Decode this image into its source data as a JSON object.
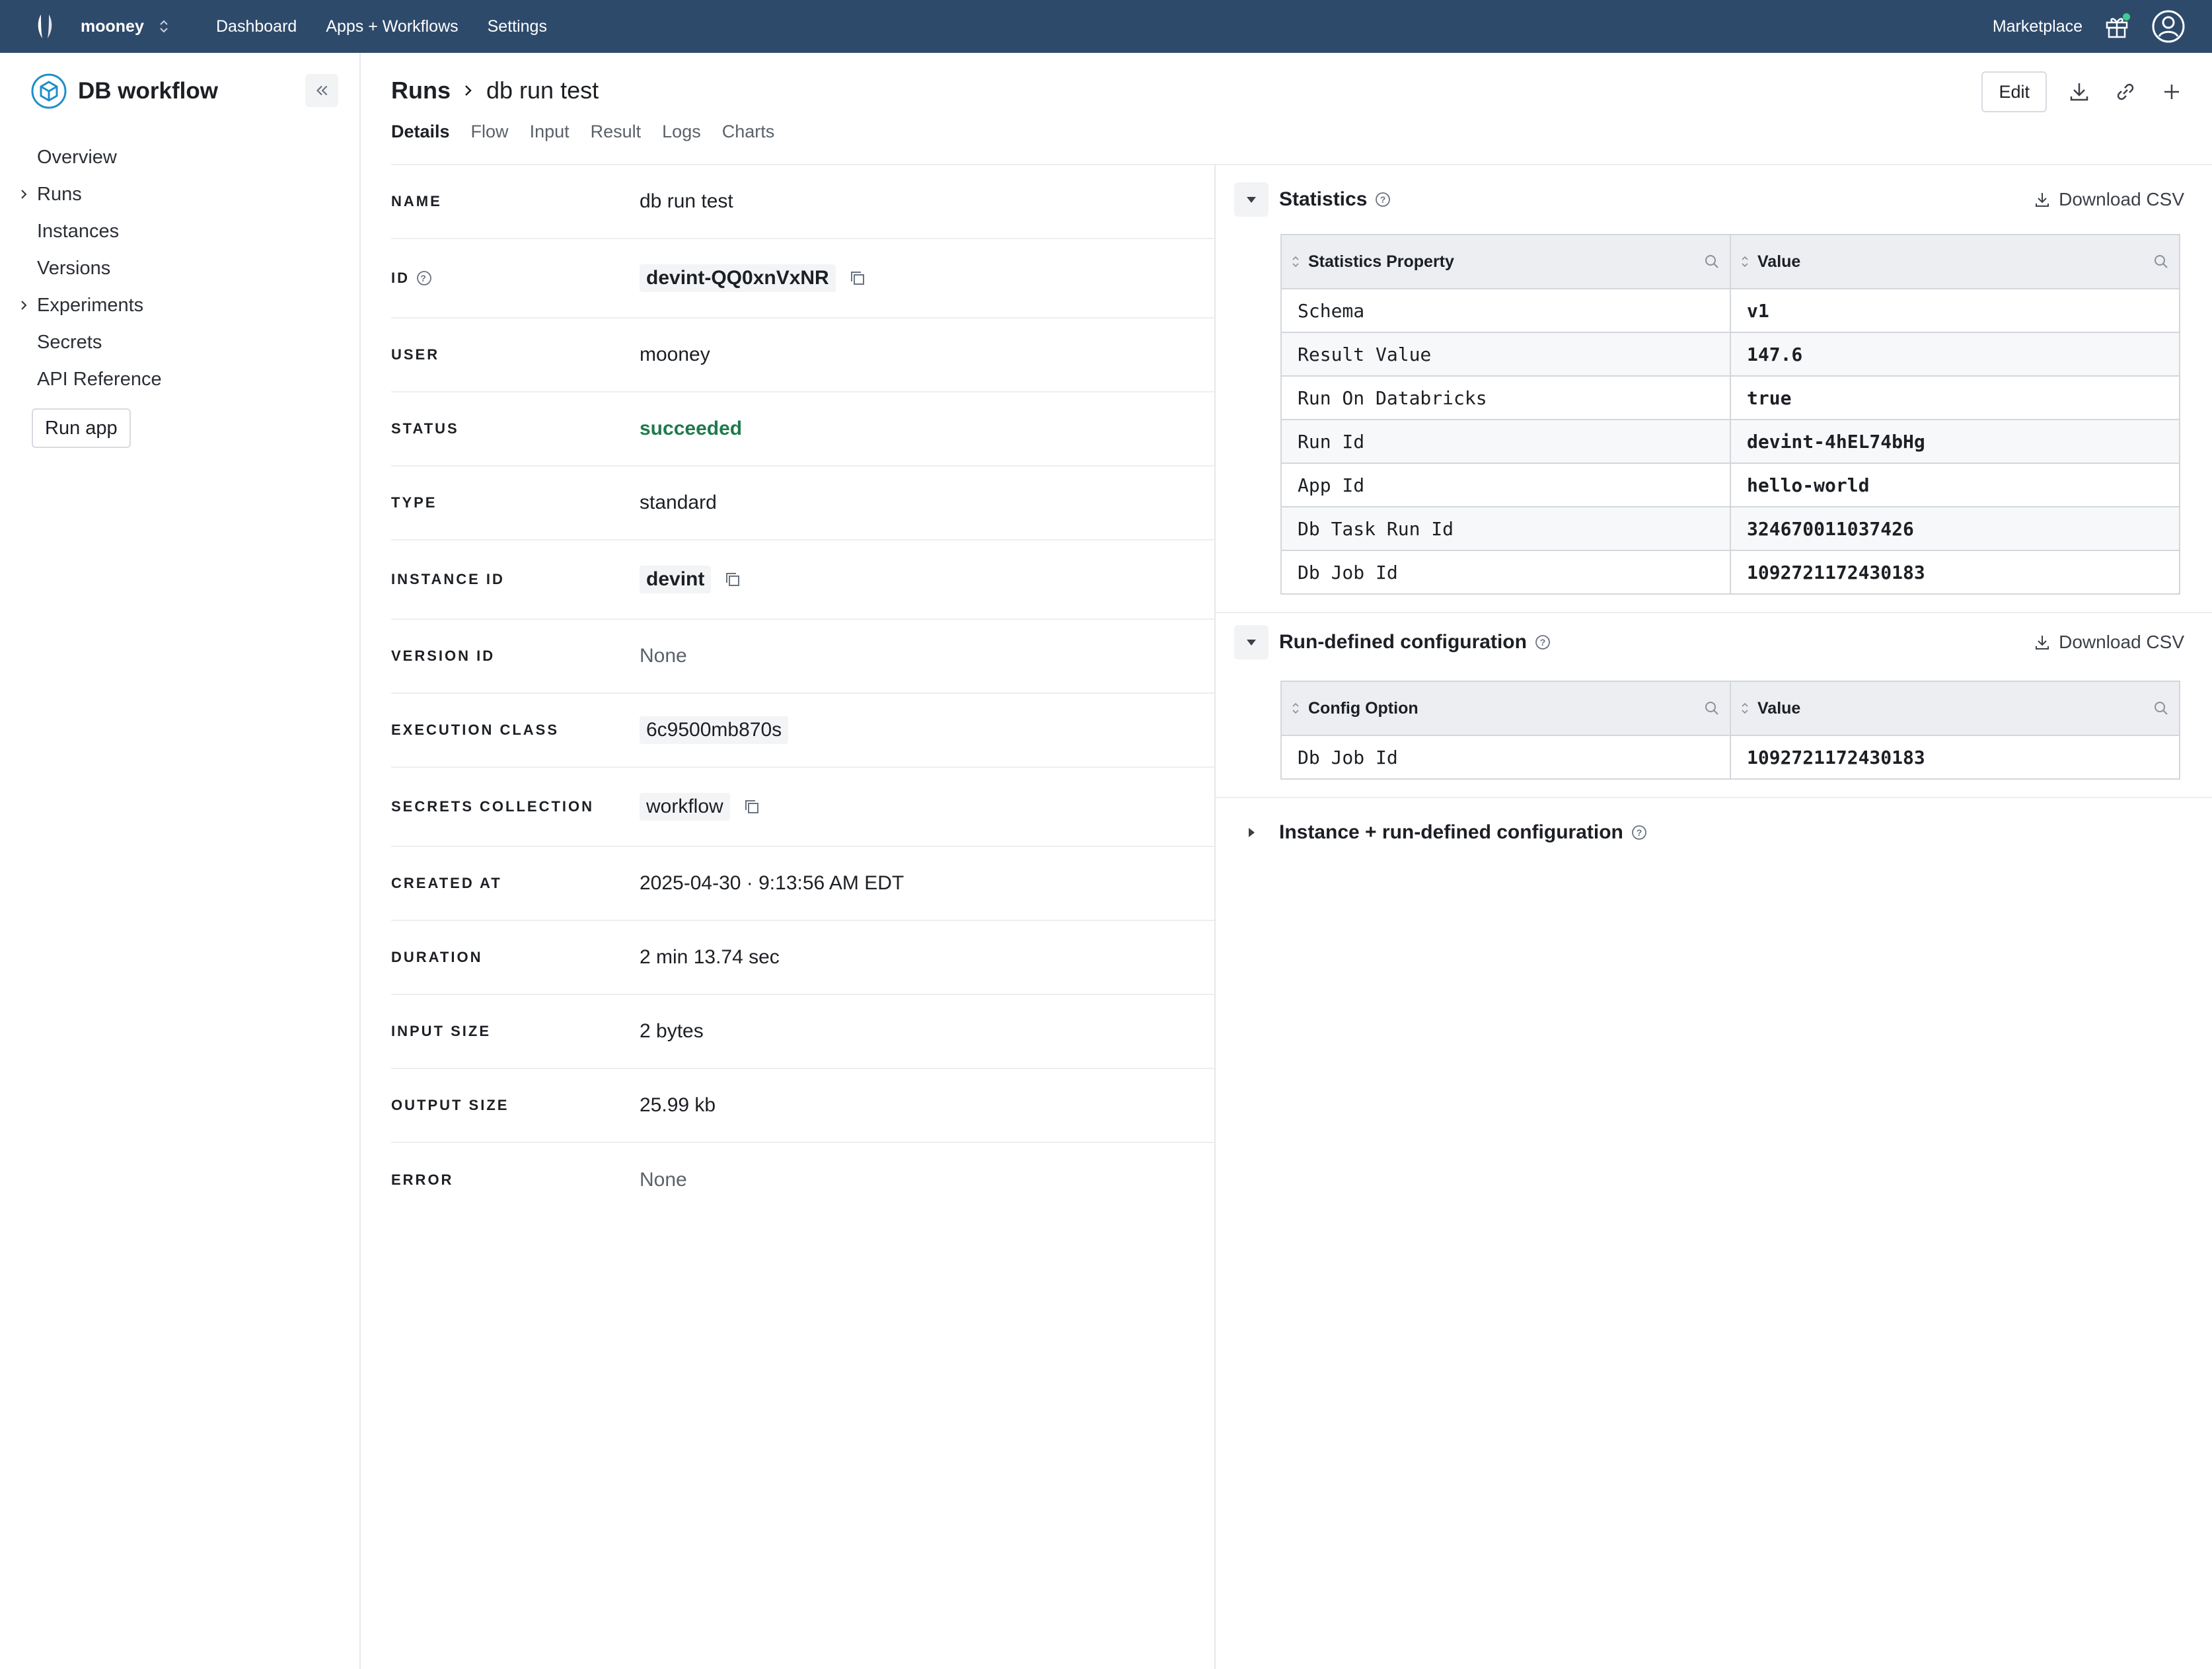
{
  "topbar": {
    "account": "mooney",
    "nav": [
      "Dashboard",
      "Apps + Workflows",
      "Settings"
    ],
    "marketplace": "Marketplace",
    "colors": {
      "bar": "#2e4a6b",
      "notification_dot": "#3ccf8e"
    }
  },
  "sidebar": {
    "app_name": "DB workflow",
    "items": [
      {
        "label": "Overview",
        "expandable": false
      },
      {
        "label": "Runs",
        "expandable": true
      },
      {
        "label": "Instances",
        "expandable": false
      },
      {
        "label": "Versions",
        "expandable": false
      },
      {
        "label": "Experiments",
        "expandable": true
      },
      {
        "label": "Secrets",
        "expandable": false
      },
      {
        "label": "API Reference",
        "expandable": false
      }
    ],
    "run_button": "Run app"
  },
  "header": {
    "breadcrumb_root": "Runs",
    "breadcrumb_current": "db run test",
    "tabs": [
      "Details",
      "Flow",
      "Input",
      "Result",
      "Logs",
      "Charts"
    ],
    "active_tab": "Details",
    "edit_label": "Edit"
  },
  "details": [
    {
      "label": "NAME",
      "value": "db run test"
    },
    {
      "label": "ID",
      "value": "devint-QQ0xnVxNR"
    },
    {
      "label": "USER",
      "value": "mooney"
    },
    {
      "label": "STATUS",
      "value": "succeeded"
    },
    {
      "label": "TYPE",
      "value": "standard"
    },
    {
      "label": "INSTANCE ID",
      "value": "devint"
    },
    {
      "label": "VERSION ID",
      "value": "None"
    },
    {
      "label": "EXECUTION CLASS",
      "value": "6c9500mb870s"
    },
    {
      "label": "SECRETS COLLECTION",
      "value": "workflow"
    },
    {
      "label": "CREATED AT",
      "value": "2025-04-30 · 9:13:56 AM EDT"
    },
    {
      "label": "DURATION",
      "value": "2 min 13.74 sec"
    },
    {
      "label": "INPUT SIZE",
      "value": "2 bytes"
    },
    {
      "label": "OUTPUT SIZE",
      "value": "25.99 kb"
    },
    {
      "label": "ERROR",
      "value": "None"
    }
  ],
  "statistics": {
    "title": "Statistics",
    "download": "Download CSV",
    "col_property": "Statistics Property",
    "col_value": "Value",
    "rows": [
      [
        "Schema",
        "v1"
      ],
      [
        "Result Value",
        "147.6"
      ],
      [
        "Run On Databricks",
        "true"
      ],
      [
        "Run Id",
        "devint-4hEL74bHg"
      ],
      [
        "App Id",
        "hello-world"
      ],
      [
        "Db Task Run Id",
        "324670011037426"
      ],
      [
        "Db Job Id",
        "1092721172430183"
      ]
    ]
  },
  "run_config": {
    "title": "Run-defined configuration",
    "download": "Download CSV",
    "col_option": "Config Option",
    "col_value": "Value",
    "rows": [
      [
        "Db Job Id",
        "1092721172430183"
      ]
    ]
  },
  "instance_config": {
    "title": "Instance + run-defined configuration"
  }
}
